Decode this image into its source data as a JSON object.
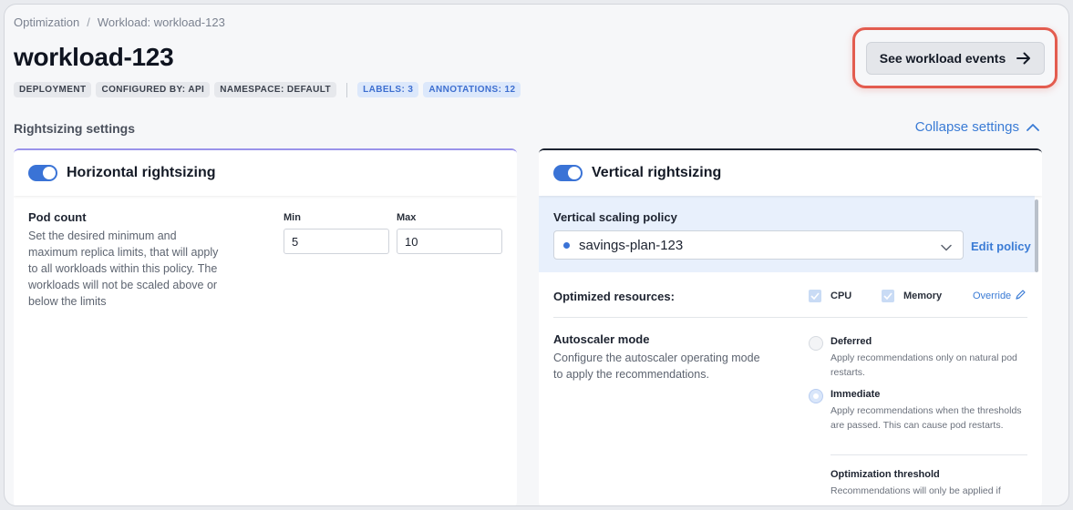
{
  "breadcrumb": {
    "root": "Optimization",
    "separator": "/",
    "current": "Workload: workload-123"
  },
  "page": {
    "title": "workload-123"
  },
  "tags": {
    "kind": "DEPLOYMENT",
    "configured_by": "CONFIGURED BY: API",
    "namespace": "NAMESPACE: DEFAULT",
    "labels": "LABELS: 3",
    "annotations": "ANNOTATIONS: 12"
  },
  "header": {
    "events_button_label": "See workload events",
    "events_icon": "arrow-right-icon"
  },
  "settings": {
    "section_title": "Rightsizing settings",
    "collapse_label": "Collapse settings",
    "collapse_icon": "chevron-up-icon"
  },
  "horizontal": {
    "title": "Horizontal rightsizing",
    "enabled": true,
    "pod_count_title": "Pod count",
    "pod_count_desc": "Set the desired minimum and maximum replica limits, that will apply to all workloads within this policy. The workloads will not be scaled above or below the limits",
    "min_label": "Min",
    "min_value": "5",
    "max_label": "Max",
    "max_value": "10"
  },
  "vertical": {
    "title": "Vertical rightsizing",
    "enabled": true,
    "policy_label": "Vertical scaling policy",
    "policy_value": "savings-plan-123",
    "edit_policy": "Edit policy",
    "optimized_label": "Optimized resources:",
    "cpu_label": "CPU",
    "memory_label": "Memory",
    "override_label": "Override",
    "autoscaler_title": "Autoscaler mode",
    "autoscaler_desc": "Configure the autoscaler operating mode to apply the recommendations.",
    "modes": [
      {
        "title": "Deferred",
        "desc": "Apply recommendations only on natural pod restarts.",
        "selected": false
      },
      {
        "title": "Immediate",
        "desc": "Apply recommendations when the thresholds are passed. This can cause pod restarts.",
        "selected": true
      }
    ],
    "threshold_title": "Optimization threshold",
    "threshold_desc": "Recommendations will only be applied if"
  },
  "colors": {
    "accent": "#3a73d6",
    "highlight": "#e35c4f",
    "link": "#3a7bd5"
  }
}
